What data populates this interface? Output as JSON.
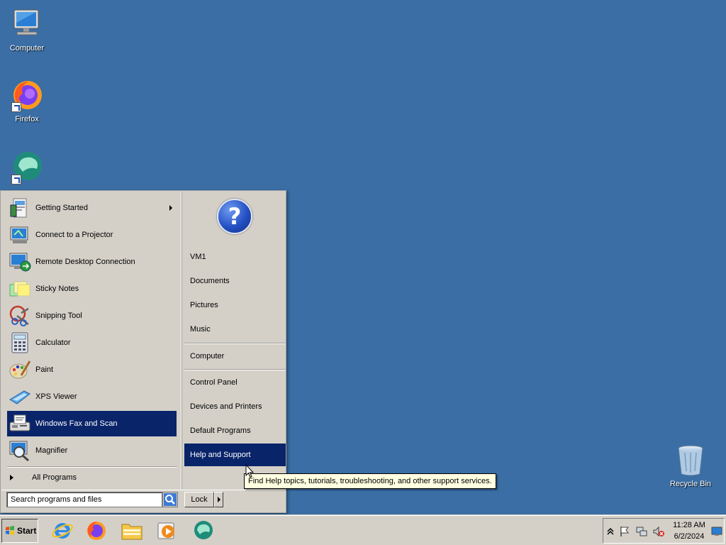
{
  "desktop": {
    "icons": [
      {
        "label": "Computer"
      },
      {
        "label": "Firefox"
      },
      {
        "label": ""
      },
      {
        "label": "Recycle Bin"
      }
    ]
  },
  "start_menu": {
    "programs": [
      {
        "label": "Getting Started",
        "icon": "getting-started-icon"
      },
      {
        "label": "Connect to a Projector",
        "icon": "projector-icon"
      },
      {
        "label": "Remote Desktop Connection",
        "icon": "remote-desktop-icon"
      },
      {
        "label": "Sticky Notes",
        "icon": "sticky-notes-icon"
      },
      {
        "label": "Snipping Tool",
        "icon": "snipping-tool-icon"
      },
      {
        "label": "Calculator",
        "icon": "calculator-icon"
      },
      {
        "label": "Paint",
        "icon": "paint-icon"
      },
      {
        "label": "XPS Viewer",
        "icon": "xps-viewer-icon"
      },
      {
        "label": "Windows Fax and Scan",
        "icon": "fax-scan-icon"
      },
      {
        "label": "Magnifier",
        "icon": "magnifier-icon"
      }
    ],
    "all_programs": "All Programs",
    "right_items": [
      {
        "label": "VM1"
      },
      {
        "label": "Documents"
      },
      {
        "label": "Pictures"
      },
      {
        "label": "Music"
      },
      {
        "label": "Computer"
      },
      {
        "label": "Control Panel"
      },
      {
        "label": "Devices and Printers"
      },
      {
        "label": "Default Programs"
      },
      {
        "label": "Help and Support"
      }
    ],
    "search_placeholder": "Search programs and files",
    "lock_label": "Lock"
  },
  "tooltip": "Find Help topics, tutorials, troubleshooting, and other support services.",
  "taskbar": {
    "start_label": "Start",
    "clock_time": "11:28 AM",
    "clock_date": "6/2/2024"
  },
  "colors": {
    "desktop": "#3a6ea5",
    "menu_face": "#d4d0c8",
    "selection": "#0a246a",
    "tooltip_bg": "#ffffe1"
  }
}
